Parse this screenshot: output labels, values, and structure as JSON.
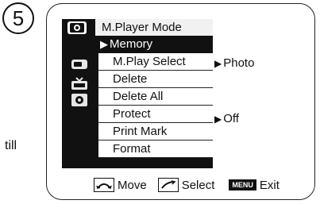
{
  "step_number": "5",
  "side_text": "till",
  "menu": {
    "header": "M.Player Mode",
    "selected": "Memory",
    "items": [
      "M.Play Select",
      "Delete",
      "Delete All",
      "Protect",
      "Print Mark",
      "Format"
    ]
  },
  "values": {
    "mplay_select": "Photo",
    "protect": "Off"
  },
  "footer": {
    "move": "Move",
    "select": "Select",
    "menu_key": "MENU",
    "exit": "Exit"
  },
  "icons": {
    "header": "camera-icon",
    "tape": "tape-icon",
    "tv": "tv-icon",
    "settings": "gear-icon",
    "move": "move-arc-icon",
    "select": "select-arc-icon"
  }
}
